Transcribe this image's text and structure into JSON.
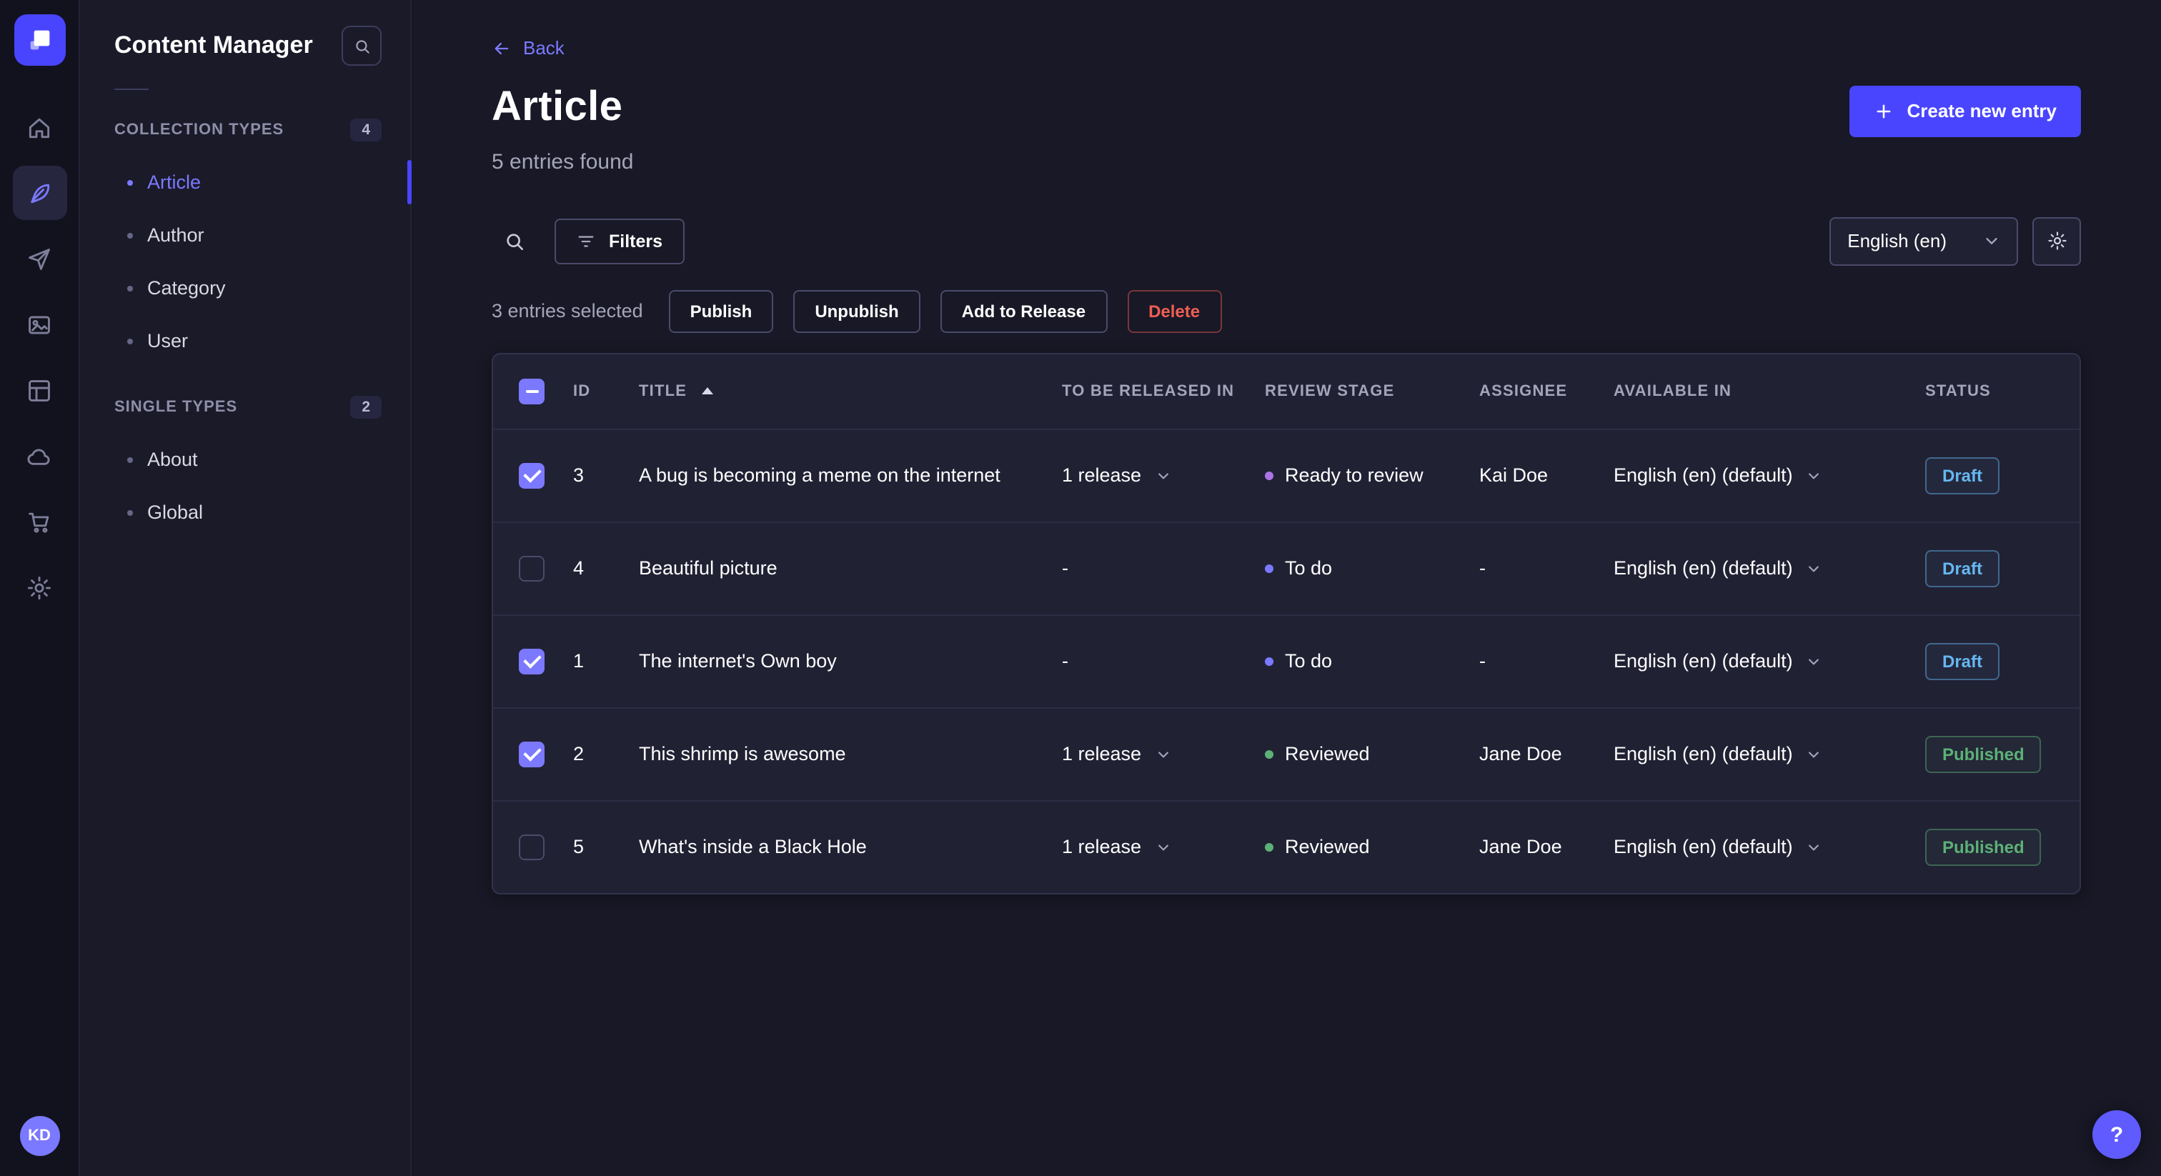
{
  "colors": {
    "primary": "#4945ff",
    "primary_light": "#7b79ff",
    "draft": "#66b7f1",
    "published": "#5cb176",
    "danger": "#ee5e52"
  },
  "navbar": {
    "items": [
      {
        "name": "home",
        "icon": "home",
        "active": false
      },
      {
        "name": "content-manager",
        "icon": "pen",
        "active": true
      },
      {
        "name": "releases",
        "icon": "plane",
        "active": false
      },
      {
        "name": "media-library",
        "icon": "image",
        "active": false
      },
      {
        "name": "content-type-builder",
        "icon": "layout",
        "active": false
      },
      {
        "name": "deploy",
        "icon": "cloud",
        "active": false
      },
      {
        "name": "marketplace",
        "icon": "cart",
        "active": false
      },
      {
        "name": "settings",
        "icon": "gear",
        "active": false
      }
    ],
    "avatar_initials": "KD"
  },
  "sidebar": {
    "title": "Content Manager",
    "sections": [
      {
        "label": "COLLECTION TYPES",
        "badge": "4",
        "items": [
          {
            "label": "Article",
            "active": true
          },
          {
            "label": "Author",
            "active": false
          },
          {
            "label": "Category",
            "active": false
          },
          {
            "label": "User",
            "active": false
          }
        ]
      },
      {
        "label": "SINGLE TYPES",
        "badge": "2",
        "items": [
          {
            "label": "About",
            "active": false
          },
          {
            "label": "Global",
            "active": false
          }
        ]
      }
    ]
  },
  "header": {
    "back_label": "Back",
    "title": "Article",
    "subtitle": "5 entries found",
    "create_button_label": "Create new entry"
  },
  "toolbar": {
    "filters_label": "Filters",
    "locale_selected": "English (en)"
  },
  "selection": {
    "count_text": "3 entries selected",
    "publish_label": "Publish",
    "unpublish_label": "Unpublish",
    "add_to_release_label": "Add to Release",
    "delete_label": "Delete"
  },
  "table": {
    "columns": {
      "id": "ID",
      "title": "TITLE",
      "release": "TO BE RELEASED IN",
      "review": "REVIEW STAGE",
      "assignee": "ASSIGNEE",
      "available": "AVAILABLE IN",
      "status": "STATUS"
    },
    "rows": [
      {
        "checked": true,
        "id": "3",
        "title": "A bug is becoming a meme on the internet",
        "release": "1 release",
        "release_menu": true,
        "review_stage": "Ready to review",
        "review_color": "#ac73e6",
        "assignee": "Kai Doe",
        "available_in": "English (en) (default)",
        "status": "Draft"
      },
      {
        "checked": false,
        "id": "4",
        "title": "Beautiful picture",
        "release": "-",
        "release_menu": false,
        "review_stage": "To do",
        "review_color": "#7b79ff",
        "assignee": "-",
        "available_in": "English (en) (default)",
        "status": "Draft"
      },
      {
        "checked": true,
        "id": "1",
        "title": "The internet's Own boy",
        "release": "-",
        "release_menu": false,
        "review_stage": "To do",
        "review_color": "#7b79ff",
        "assignee": "-",
        "available_in": "English (en) (default)",
        "status": "Draft"
      },
      {
        "checked": true,
        "id": "2",
        "title": "This shrimp is awesome",
        "release": "1 release",
        "release_menu": true,
        "review_stage": "Reviewed",
        "review_color": "#5cb176",
        "assignee": "Jane Doe",
        "available_in": "English (en) (default)",
        "status": "Published"
      },
      {
        "checked": false,
        "id": "5",
        "title": "What's inside a Black Hole",
        "release": "1 release",
        "release_menu": true,
        "review_stage": "Reviewed",
        "review_color": "#5cb176",
        "assignee": "Jane Doe",
        "available_in": "English (en) (default)",
        "status": "Published"
      }
    ]
  },
  "help": {
    "label": "?"
  }
}
